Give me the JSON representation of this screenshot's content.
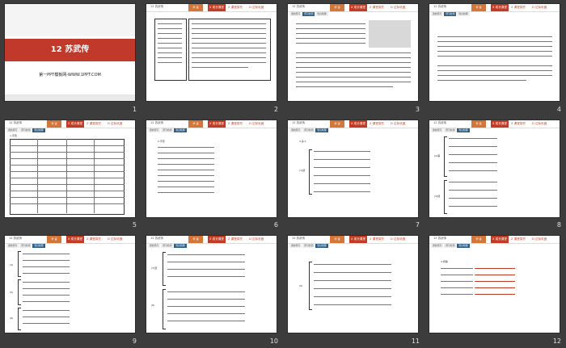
{
  "slides": [
    {
      "number": "1",
      "title": "12 苏武传",
      "footer": "第一PPT模板网-WWW.1PPT.COM"
    },
    {
      "number": "2",
      "lesson": "12 苏武传"
    },
    {
      "number": "3",
      "lesson": "12 苏武传"
    },
    {
      "number": "4",
      "lesson": "12 苏武传"
    },
    {
      "number": "5",
      "lesson": "12 苏武传"
    },
    {
      "number": "6",
      "lesson": "12 苏武传"
    },
    {
      "number": "7",
      "lesson": "12 苏武传"
    },
    {
      "number": "8",
      "lesson": "12 苏武传"
    },
    {
      "number": "9",
      "lesson": "12 苏武传"
    },
    {
      "number": "10",
      "lesson": "12 苏武传"
    },
    {
      "number": "11",
      "lesson": "12 苏武传"
    },
    {
      "number": "12",
      "lesson": "12 苏武传"
    }
  ],
  "header_tabs": {
    "yy": "学 语",
    "t1": "X 成长课堂",
    "t2": "Z 课堂探究",
    "t3": "D 达标巩固"
  },
  "sub_tabs": [
    "课前预习",
    "预习检测",
    "知识梳理"
  ],
  "s5": {
    "title": "1.字音"
  },
  "s6": {
    "title": "2.字形"
  },
  "s7": {
    "title": "3.多义",
    "label": "(1)使"
  },
  "s8": {
    "label1": "(2)事",
    "label2": "(3)使"
  },
  "s9": {
    "label1": "(4)",
    "label2": "(5)",
    "label3": "(6)"
  },
  "s10": {
    "label1": "(7)置",
    "label2": "(8)"
  },
  "s11": {
    "label1": "(9)"
  },
  "s12": {
    "title": "4.特殊"
  },
  "colors": {
    "accent": "#c23b22",
    "cover_band": "#c0392b",
    "sub_tab_active": "#2b5f8a",
    "background": "#3c3c3c"
  }
}
